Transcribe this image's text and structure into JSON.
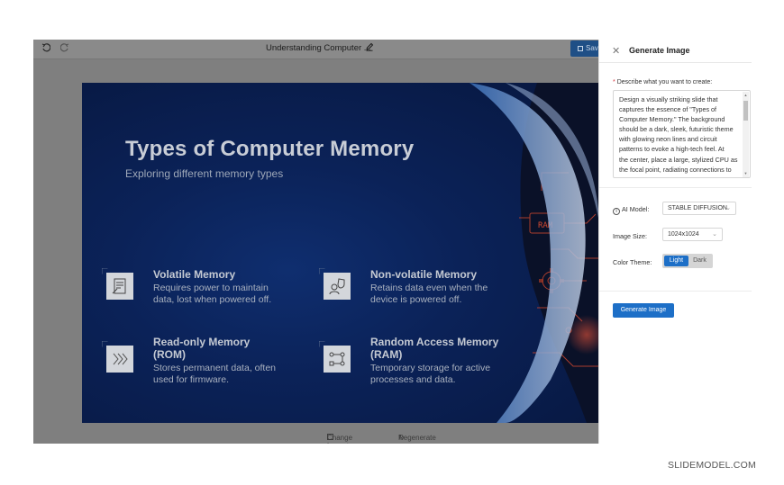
{
  "toolbar": {
    "undo_icon": "undo-icon",
    "redo_icon": "redo-icon",
    "document_title": "Understanding Computer ...",
    "edit_icon": "pencil-icon",
    "save_label": "Sav"
  },
  "slide": {
    "title": "Types of Computer Memory",
    "subtitle": "Exploring different memory types",
    "cards": [
      {
        "title": "Volatile Memory",
        "lines": [
          "Requires power to maintain",
          "data, lost when powered off."
        ],
        "icon": "memory-chip-icon"
      },
      {
        "title": "Non-volatile Memory",
        "lines": [
          "Retains data even when the",
          "device is powered off."
        ],
        "icon": "user-shield-icon"
      },
      {
        "title_lines": [
          "Read-only Memory",
          "(ROM)"
        ],
        "lines": [
          "Stores permanent data, often",
          "used for firmware."
        ],
        "icon": "chevrons-right-icon"
      },
      {
        "title_lines": [
          "Random Access Memory",
          "(RAM)"
        ],
        "lines": [
          "Temporary storage for active",
          "processes and data."
        ],
        "icon": "flow-diagram-icon"
      }
    ],
    "deco_text": "RAM"
  },
  "bottom_bar": {
    "change_layout": "Change Layout",
    "regenerate": "Regenerate"
  },
  "panel": {
    "title": "Generate Image",
    "prompt_label": "Describe what you want to create:",
    "prompt_lines": [
      "Design a visually striking slide that",
      "captures the essence of \"Types of",
      "Computer Memory.\" The background",
      "should be a dark, sleek, futuristic theme",
      "with glowing neon lines and circuit",
      "patterns to evoke a high-tech feel. At",
      "the center, place a large, stylized CPU as",
      "the focal point, radiating connections to"
    ],
    "ai_model_label": "AI Model:",
    "ai_model_value": "STABLE DIFFUSION",
    "image_size_label": "Image Size:",
    "image_size_value": "1024x1024",
    "color_theme_label": "Color Theme:",
    "theme_options": [
      "Light",
      "Dark"
    ],
    "theme_selected": "Light",
    "generate_button": "Generate Image"
  },
  "watermark": "SLIDEMODEL.COM",
  "colors": {
    "accent": "#1d6fc7",
    "slide_bg": "#0b2258"
  }
}
